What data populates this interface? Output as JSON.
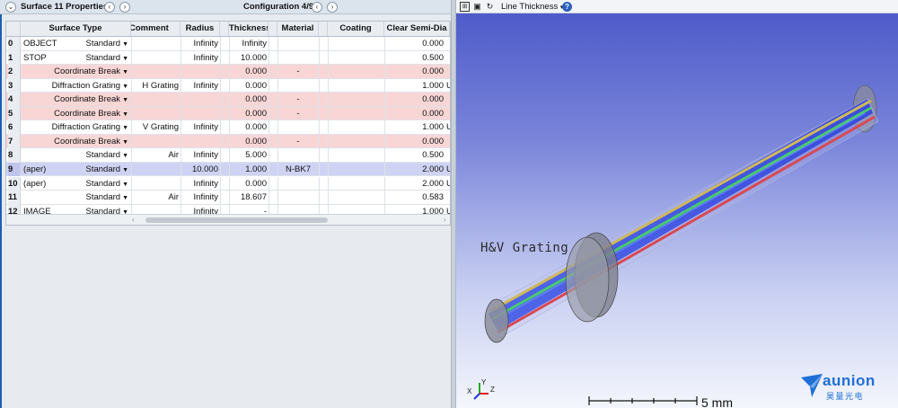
{
  "lde": {
    "surface_label": "Surface  11 Properties",
    "config_label": "Configuration 4/9",
    "columns": [
      "Surface Type",
      "Comment",
      "Radius",
      "Thickness",
      "Material",
      "Coating",
      "Clear Semi-Dia"
    ],
    "rows": [
      {
        "num": "0",
        "name": "OBJECT",
        "type": "Standard",
        "comment": "",
        "radius": "Infinity",
        "thickness": "Infinity",
        "material": "",
        "coating": "",
        "semidia": "0.000",
        "flag": "",
        "style": "wh"
      },
      {
        "num": "1",
        "name": "STOP",
        "type": "Standard",
        "comment": "",
        "radius": "Infinity",
        "thickness": "10.000",
        "material": "",
        "coating": "",
        "semidia": "0.500",
        "flag": "",
        "style": "wh"
      },
      {
        "num": "2",
        "name": "",
        "type": "Coordinate Break",
        "comment": "",
        "radius": "",
        "thickness": "0.000",
        "material": "-",
        "coating": "",
        "semidia": "0.000",
        "flag": "",
        "style": "cb"
      },
      {
        "num": "3",
        "name": "",
        "type": "Diffraction Grating",
        "comment": "H Grating",
        "radius": "Infinity",
        "thickness": "0.000",
        "material": "",
        "coating": "",
        "semidia": "1.000",
        "flag": "U",
        "style": "wh"
      },
      {
        "num": "4",
        "name": "",
        "type": "Coordinate Break",
        "comment": "",
        "radius": "",
        "thickness": "0.000",
        "material": "-",
        "coating": "",
        "semidia": "0.000",
        "flag": "",
        "style": "cb"
      },
      {
        "num": "5",
        "name": "",
        "type": "Coordinate Break",
        "comment": "",
        "radius": "",
        "thickness": "0.000",
        "material": "-",
        "coating": "",
        "semidia": "0.000",
        "flag": "",
        "style": "cb"
      },
      {
        "num": "6",
        "name": "",
        "type": "Diffraction Grating",
        "comment": "V Grating",
        "radius": "Infinity",
        "thickness": "0.000",
        "material": "",
        "coating": "",
        "semidia": "1.000",
        "flag": "U",
        "style": "wh"
      },
      {
        "num": "7",
        "name": "",
        "type": "Coordinate Break",
        "comment": "",
        "radius": "",
        "thickness": "0.000",
        "material": "-",
        "coating": "",
        "semidia": "0.000",
        "flag": "",
        "style": "cb"
      },
      {
        "num": "8",
        "name": "",
        "type": "Standard",
        "comment": "Air",
        "radius": "Infinity",
        "thickness": "5.000",
        "material": "",
        "coating": "",
        "semidia": "0.500",
        "flag": "",
        "style": "wh"
      },
      {
        "num": "9",
        "name": "(aper)",
        "type": "Standard",
        "comment": "",
        "radius": "10.000",
        "thickness": "1.000",
        "material": "N-BK7",
        "coating": "",
        "semidia": "2.000",
        "flag": "U",
        "style": "sel"
      },
      {
        "num": "10",
        "name": "(aper)",
        "type": "Standard",
        "comment": "",
        "radius": "Infinity",
        "thickness": "0.000",
        "material": "",
        "coating": "",
        "semidia": "2.000",
        "flag": "U",
        "style": "wh"
      },
      {
        "num": "11",
        "name": "",
        "type": "Standard",
        "comment": "Air",
        "radius": "Infinity",
        "thickness": "18.607",
        "material": "",
        "coating": "",
        "semidia": "0.583",
        "flag": "",
        "style": "wh"
      },
      {
        "num": "12",
        "name": "IMAGE",
        "type": "Standard",
        "comment": "",
        "radius": "Infinity",
        "thickness": "-",
        "material": "",
        "coating": "",
        "semidia": "1.000",
        "flag": "U",
        "style": "wh"
      }
    ]
  },
  "viewer": {
    "line_thickness_label": "Line Thickness",
    "annotation": "H&V Grating",
    "scale_text": "5 mm",
    "axis_labels": {
      "x": "X",
      "y": "Y",
      "z": "Z"
    },
    "logo_name": "aunion",
    "logo_cn": "昊量光电",
    "ray_colors": [
      "#d4b52a",
      "#22cc44",
      "#e02020",
      "#1030e0"
    ]
  }
}
